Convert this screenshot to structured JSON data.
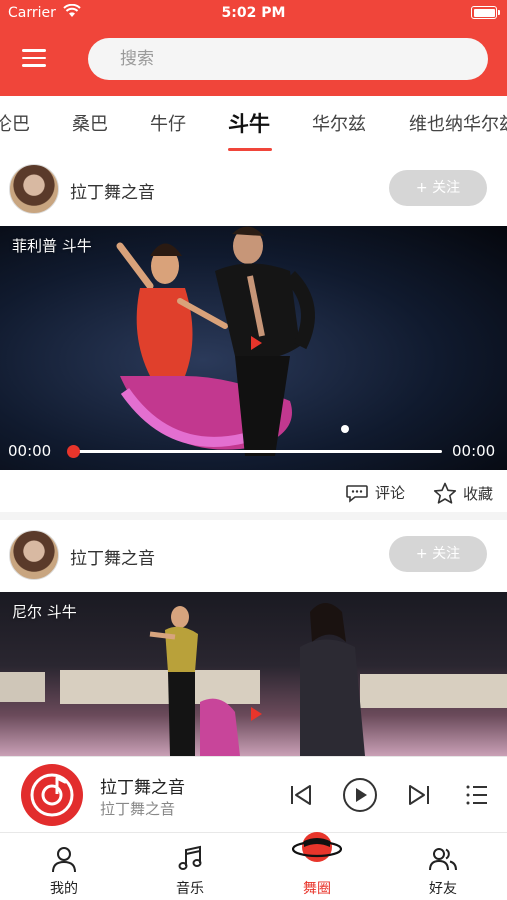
{
  "status_bar": {
    "carrier": "Carrier",
    "time": "5:02 PM"
  },
  "header": {
    "search_placeholder": "搜索"
  },
  "categories": {
    "items": [
      "伦巴",
      "桑巴",
      "牛仔",
      "斗牛",
      "华尔兹",
      "维也纳华尔兹"
    ],
    "active": "斗牛"
  },
  "posts": [
    {
      "author": "拉丁舞之音",
      "follow_label": "+ 关注",
      "video_title": "菲利普 斗牛",
      "current_time": "00:00",
      "duration": "00:00",
      "progress": 0,
      "comment_label": "评论",
      "favorite_label": "收藏"
    },
    {
      "author": "拉丁舞之音",
      "follow_label": "+ 关注",
      "video_title": "尼尔 斗牛"
    }
  ],
  "player": {
    "title": "拉丁舞之音",
    "artist": "拉丁舞之音"
  },
  "tabbar": {
    "items": [
      {
        "label": "我的",
        "icon": "person-icon"
      },
      {
        "label": "音乐",
        "icon": "music-note-icon"
      },
      {
        "label": "舞圈",
        "icon": "planet-icon"
      },
      {
        "label": "好友",
        "icon": "friends-icon"
      }
    ],
    "active": "舞圈"
  },
  "colors": {
    "brand": "#f0453a",
    "accent": "#e8352b",
    "follow_btn": "#d6d6d6"
  }
}
